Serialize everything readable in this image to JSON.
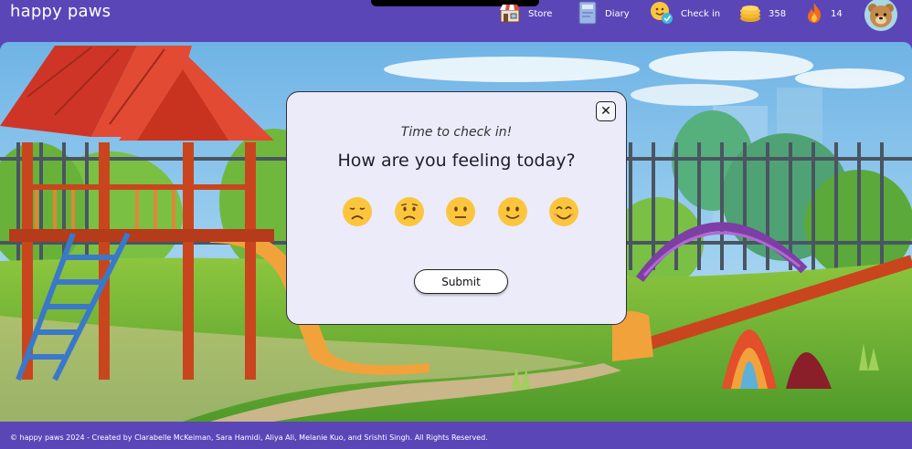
{
  "header": {
    "brand": "happy paws",
    "nav": {
      "store": "Store",
      "diary": "Diary",
      "checkin": "Check in",
      "coins": "358",
      "streak": "14"
    }
  },
  "modal": {
    "subtitle": "Time to check in!",
    "question": "How are you feeling today?",
    "moods": [
      "very-sad",
      "sad",
      "neutral",
      "happy",
      "very-happy"
    ],
    "submit_label": "Submit",
    "close_glyph": "✕"
  },
  "footer": {
    "copyright": "© happy paws 2024 - Created by Clarabelle McKeiman, Sara Hamidi, Aliya Ali, Melanie Kuo, and Srishti Singh. All Rights Reserved."
  },
  "colors": {
    "brand_purple": "#5b46b8",
    "modal_bg": "#ecebfa",
    "emoji_yellow": "#fbc63d"
  }
}
